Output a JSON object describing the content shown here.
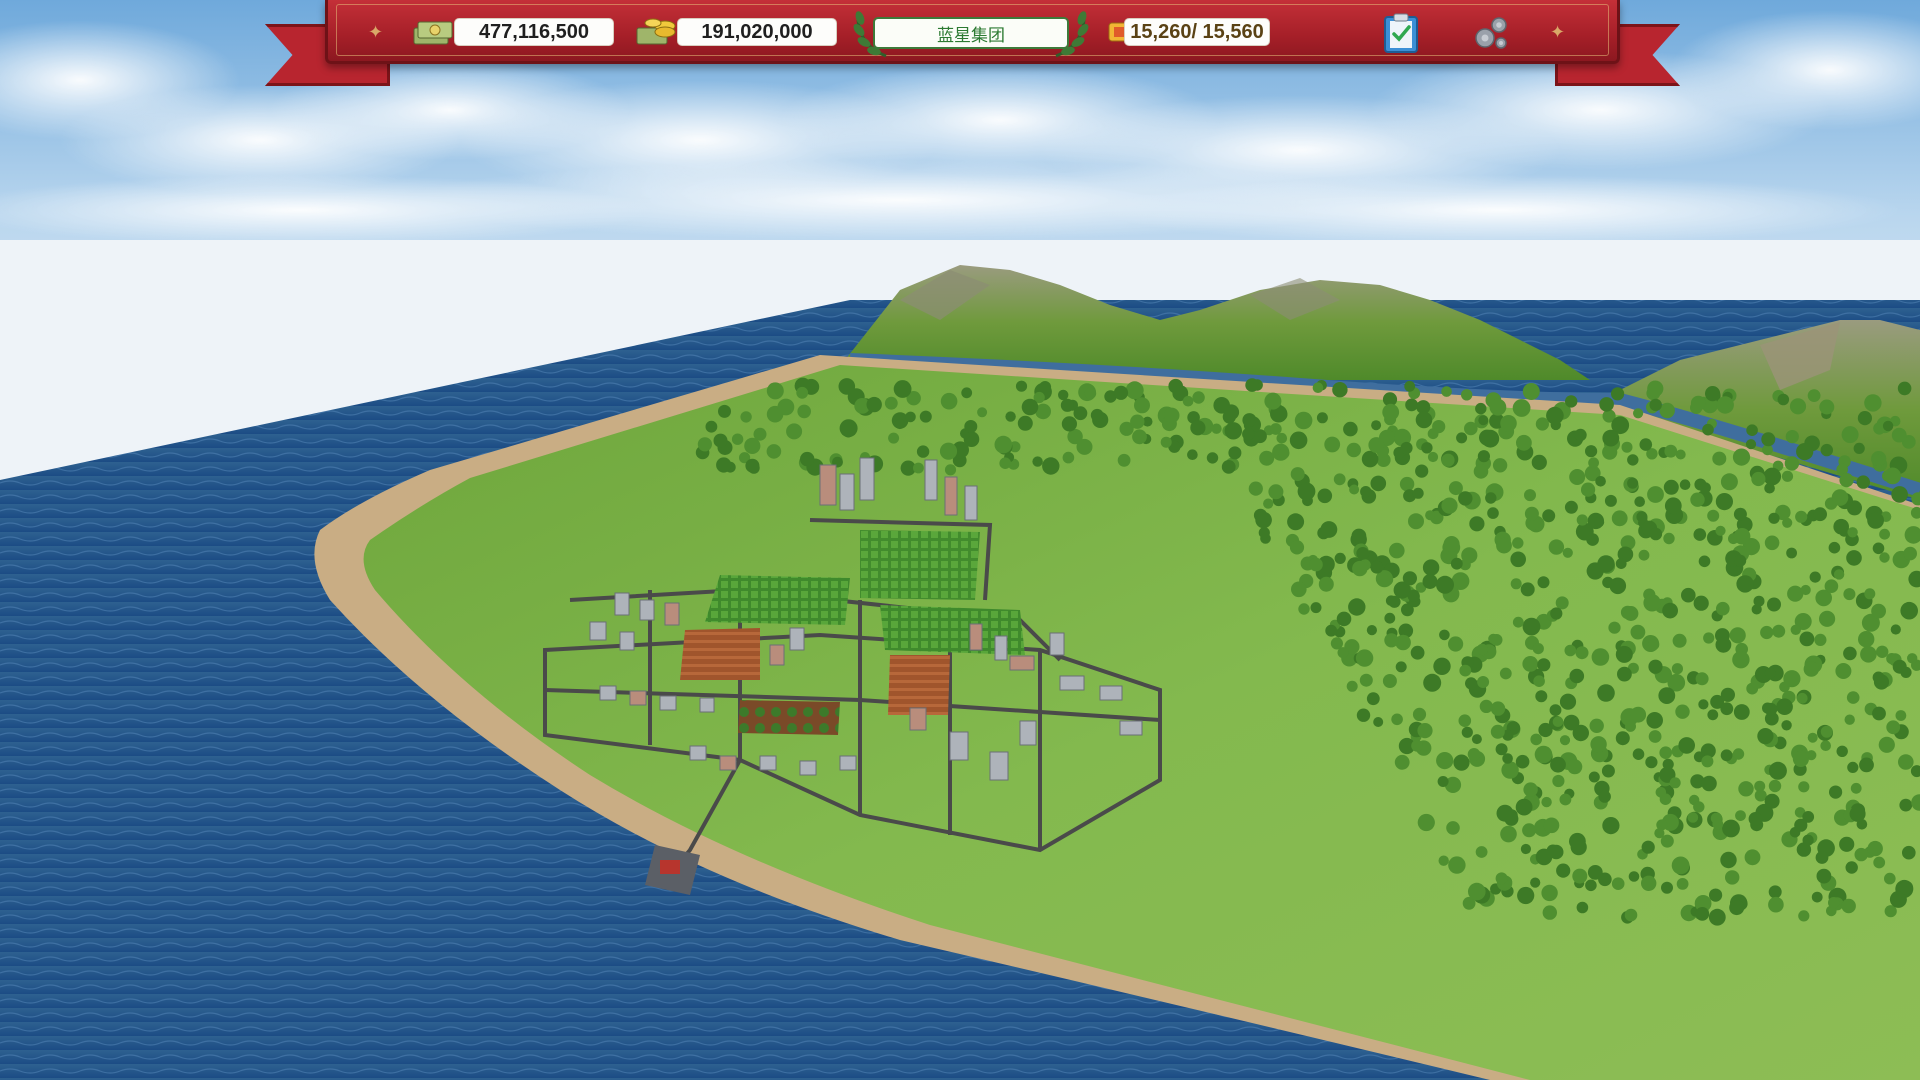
{
  "hud": {
    "cash_value": "477,116,500",
    "assets_value": "191,020,000",
    "company_name": "蓝星集团",
    "capacity_value": "15,260/ 15,560",
    "icons": {
      "cash": "money-stack-icon",
      "assets": "coin-stack-icon",
      "capacity": "ticket-icon",
      "tasks": "clipboard-check-icon",
      "settings": "gear-icon"
    }
  },
  "colors": {
    "ribbon_red": "#a51f28",
    "ocean": "#1f4f86",
    "grass": "#7fb548",
    "sand": "#c9ad84",
    "title_green": "#2c7a32"
  }
}
